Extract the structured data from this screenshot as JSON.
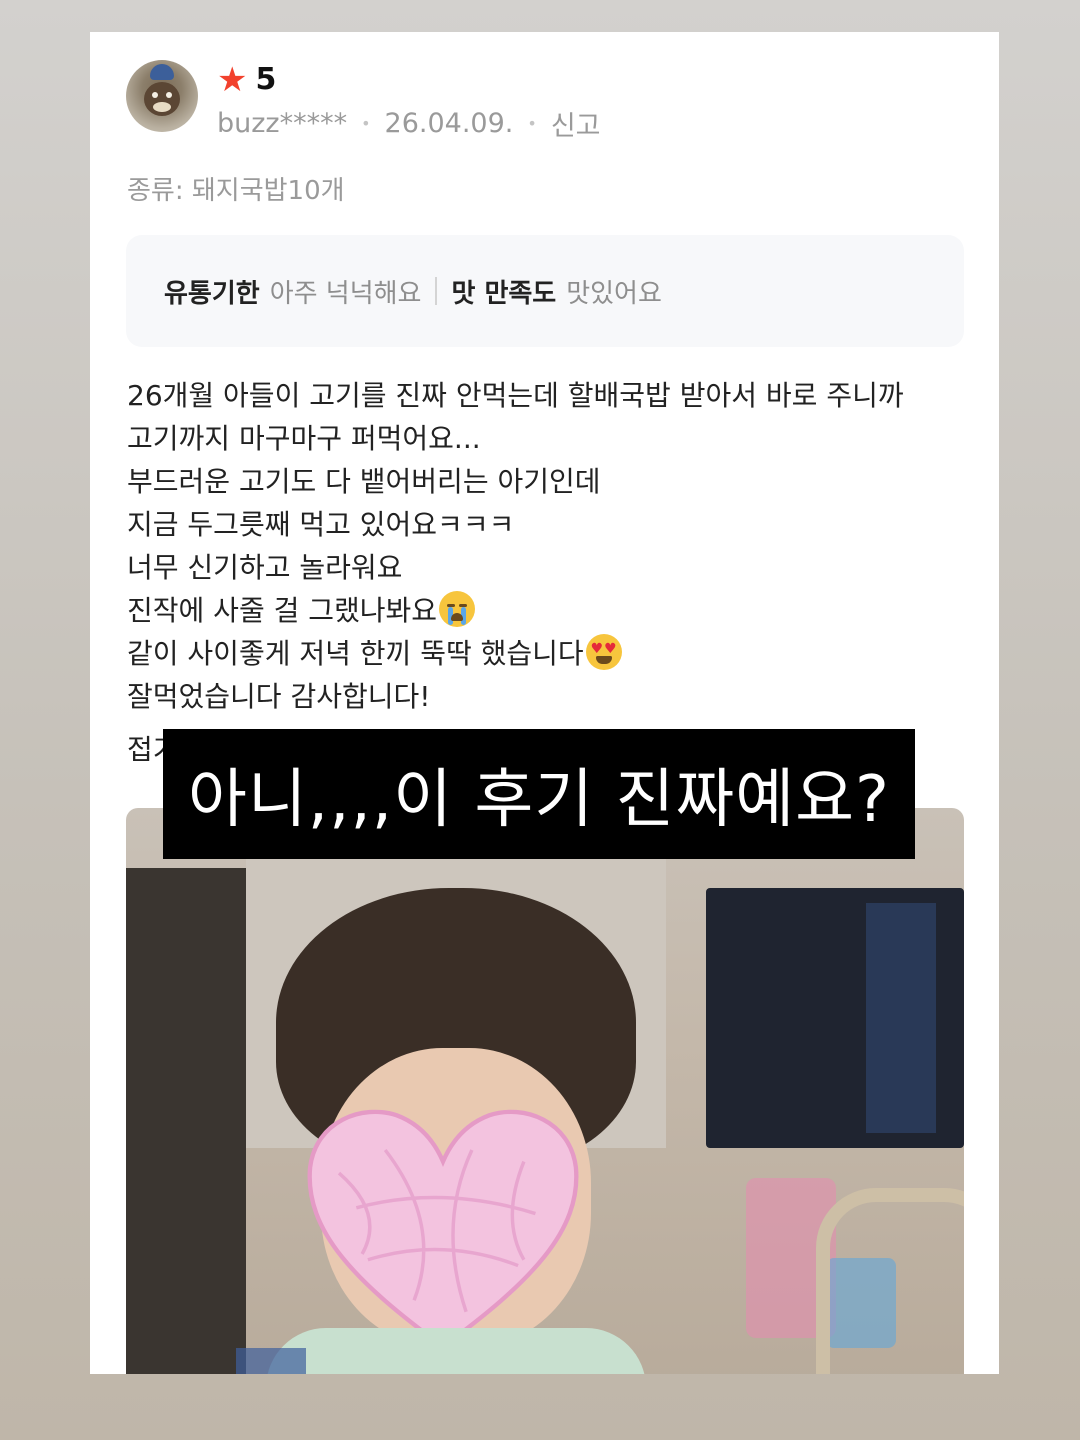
{
  "review": {
    "rating": "5",
    "username": "buzz*****",
    "date": "26.04.09.",
    "report_label": "신고",
    "option": "종류: 돼지국밥10개",
    "summary": [
      {
        "key": "유통기한",
        "value": "아주 넉넉해요"
      },
      {
        "key": "맛 만족도",
        "value": "맛있어요"
      }
    ],
    "body_lines": [
      "26개월 아들이 고기를 진짜 안먹는데 할배국밥 받아서 바로 주니까",
      "고기까지 마구마구 퍼먹어요...",
      "부드러운 고기도 다 뱉어버리는 아기인데",
      "지금 두그릇째 먹고 있어요ㅋㅋㅋ",
      "너무 신기하고 놀라워요",
      "진작에 사줄 걸 그랬나봐요",
      "같이 사이좋게 저녁 한끼 뚝딱 했습니다",
      "잘먹었습니다 감사합니다!"
    ],
    "fold_label": "접기"
  },
  "overlay_caption": "아니,,,,이 후기 진짜예요?",
  "icons": {
    "star": "star-icon",
    "emoji_1": "loudly-crying-face-emoji",
    "emoji_2": "heart-eyes-face-emoji"
  },
  "colors": {
    "star": "#f2412d",
    "caption_bg": "#000000",
    "caption_text": "#ffffff"
  }
}
